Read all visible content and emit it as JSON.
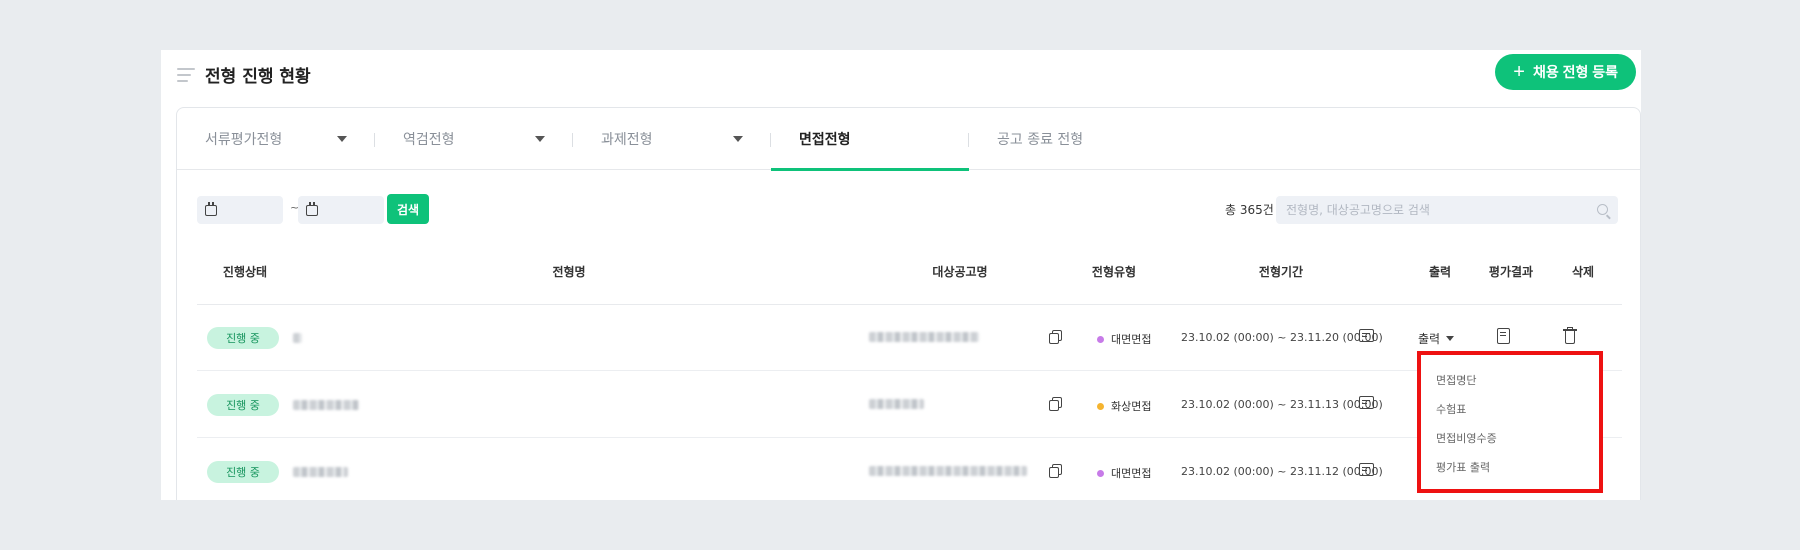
{
  "header": {
    "title": "전형 진행 현황",
    "register_label": "채용 전형 등록"
  },
  "tabs": [
    {
      "label": "서류평가전형",
      "has_caret": true,
      "active": false
    },
    {
      "label": "역검전형",
      "has_caret": true,
      "active": false
    },
    {
      "label": "과제전형",
      "has_caret": true,
      "active": false
    },
    {
      "label": "면접전형",
      "has_caret": false,
      "active": true
    },
    {
      "label": "공고 종료 전형",
      "has_caret": false,
      "active": false
    }
  ],
  "filters": {
    "date_separator": "~",
    "search_button": "검색",
    "total": "총 365건",
    "search_placeholder": "전형명, 대상공고명으로 검색"
  },
  "columns": [
    "진행상태",
    "전형명",
    "대상공고명",
    "전형유형",
    "전형기간",
    "출력",
    "평가결과",
    "삭제"
  ],
  "rows": [
    {
      "status": "진행 중",
      "type": "대면면접",
      "type_color": "#c77be8",
      "period": "23.10.02 (00:00) ~ 23.11.20 (00:00)",
      "print": "출력"
    },
    {
      "status": "진행 중",
      "type": "화상면접",
      "type_color": "#f5b430",
      "period": "23.10.02 (00:00) ~ 23.11.13 (00:00)",
      "print": ""
    },
    {
      "status": "진행 중",
      "type": "대면면접",
      "type_color": "#c77be8",
      "period": "23.10.02 (00:00) ~ 23.11.12 (00:00)",
      "print": ""
    }
  ],
  "print_menu": [
    "면접명단",
    "수험표",
    "면접비영수증",
    "평가표 출력"
  ],
  "colors": {
    "accent": "#0ec27a",
    "highlight": "#ee1111"
  }
}
